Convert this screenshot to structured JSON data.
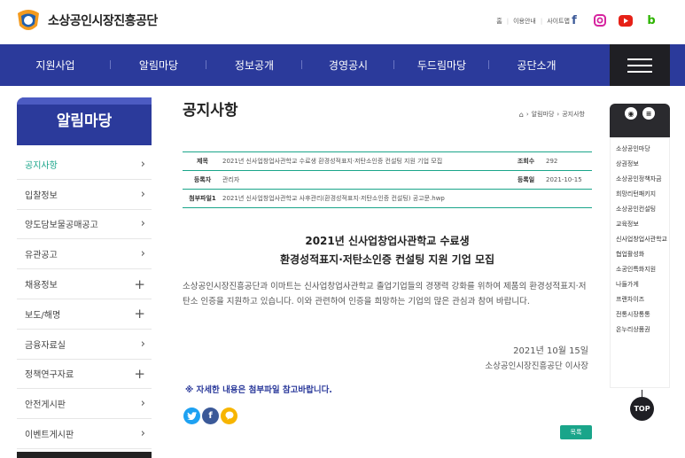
{
  "header": {
    "logo_text": "소상공인시장진흥공단",
    "util_links": [
      "홈",
      "이용안내",
      "사이트맵"
    ],
    "sns": [
      {
        "name": "facebook-icon",
        "glyph": "f",
        "color": "#3b5998"
      },
      {
        "name": "instagram-icon",
        "glyph": "◎",
        "color": "#d6249f"
      },
      {
        "name": "youtube-icon",
        "glyph": "▶",
        "color": "#e62117"
      },
      {
        "name": "blog-icon",
        "glyph": "b",
        "color": "#2db400"
      }
    ]
  },
  "nav": {
    "items": [
      "지원사업",
      "알림마당",
      "정보공개",
      "경영공시",
      "두드림마당",
      "공단소개"
    ]
  },
  "sidebar": {
    "title": "알림마당",
    "items": [
      {
        "label": "공지사항",
        "mark": "›",
        "active": true
      },
      {
        "label": "입찰정보",
        "mark": "›"
      },
      {
        "label": "양도담보물공매공고",
        "mark": "›"
      },
      {
        "label": "유관공고",
        "mark": "›"
      },
      {
        "label": "채용정보",
        "mark": "+"
      },
      {
        "label": "보도/해명",
        "mark": "+"
      },
      {
        "label": "금융자료실",
        "mark": "›"
      },
      {
        "label": "정책연구자료",
        "mark": "+"
      },
      {
        "label": "안전게시판",
        "mark": "›"
      },
      {
        "label": "이벤트게시판",
        "mark": "›"
      }
    ]
  },
  "main": {
    "title": "공지사항",
    "breadcrumb": [
      "알림마당",
      "공지사항"
    ],
    "info": {
      "subject_label": "제목",
      "subject": "2021년 신사업창업사관학교 수료생 환경성적표지·저탄소인증 컨설팅 지원 기업 모집",
      "views_label": "조회수",
      "views": "292",
      "author_label": "등록자",
      "author": "관리자",
      "date_label": "등록일",
      "date": "2021-10-15",
      "attach_label": "첨부파일1",
      "attach": "2021년 신사업창업사관학교 사후관리(환경성적표지·저탄소인증 컨설팅) 공고문.hwp"
    },
    "article_title_1": "2021년 신사업창업사관학교 수료생",
    "article_title_2": "환경성적표지·저탄소인증 컨설팅 지원 기업 모집",
    "body": "소상공인시장진흥공단과 이마트는 신사업창업사관학교 졸업기업들의 경쟁력 강화를 위하여 제품의 환경성적표지·저탄소 인증을 지원하고 있습니다. 이와 관련하여 인증을 희망하는 기업의 많은 관심과 참여 바랍니다.",
    "sign_date": "2021년 10월 15일",
    "sign_org": "소상공인시장진흥공단 이사장",
    "note": "※ 자세한 내용은 첨부파일 참고바랍니다.",
    "share": [
      {
        "name": "twitter-share-icon",
        "glyph": "t",
        "color": "#1da1f2"
      },
      {
        "name": "facebook-share-icon",
        "glyph": "f",
        "color": "#3b5998"
      },
      {
        "name": "kakao-share-icon",
        "glyph": "k",
        "color": "#f7b500"
      }
    ],
    "list_button": "목록"
  },
  "quick": {
    "items": [
      "소상공인마당",
      "상권정보",
      "소상공인정책자금",
      "희망리턴패키지",
      "소상공인컨설팅",
      "교육정보",
      "신사업창업사관학교",
      "협업활성화",
      "소공인특화지원",
      "나들가게",
      "프랜차이즈",
      "전통시장통통",
      "온누리상품권"
    ],
    "top_label": "TOP"
  },
  "colors": {
    "nav": "#2b3a9b",
    "accent": "#1aa58a"
  }
}
